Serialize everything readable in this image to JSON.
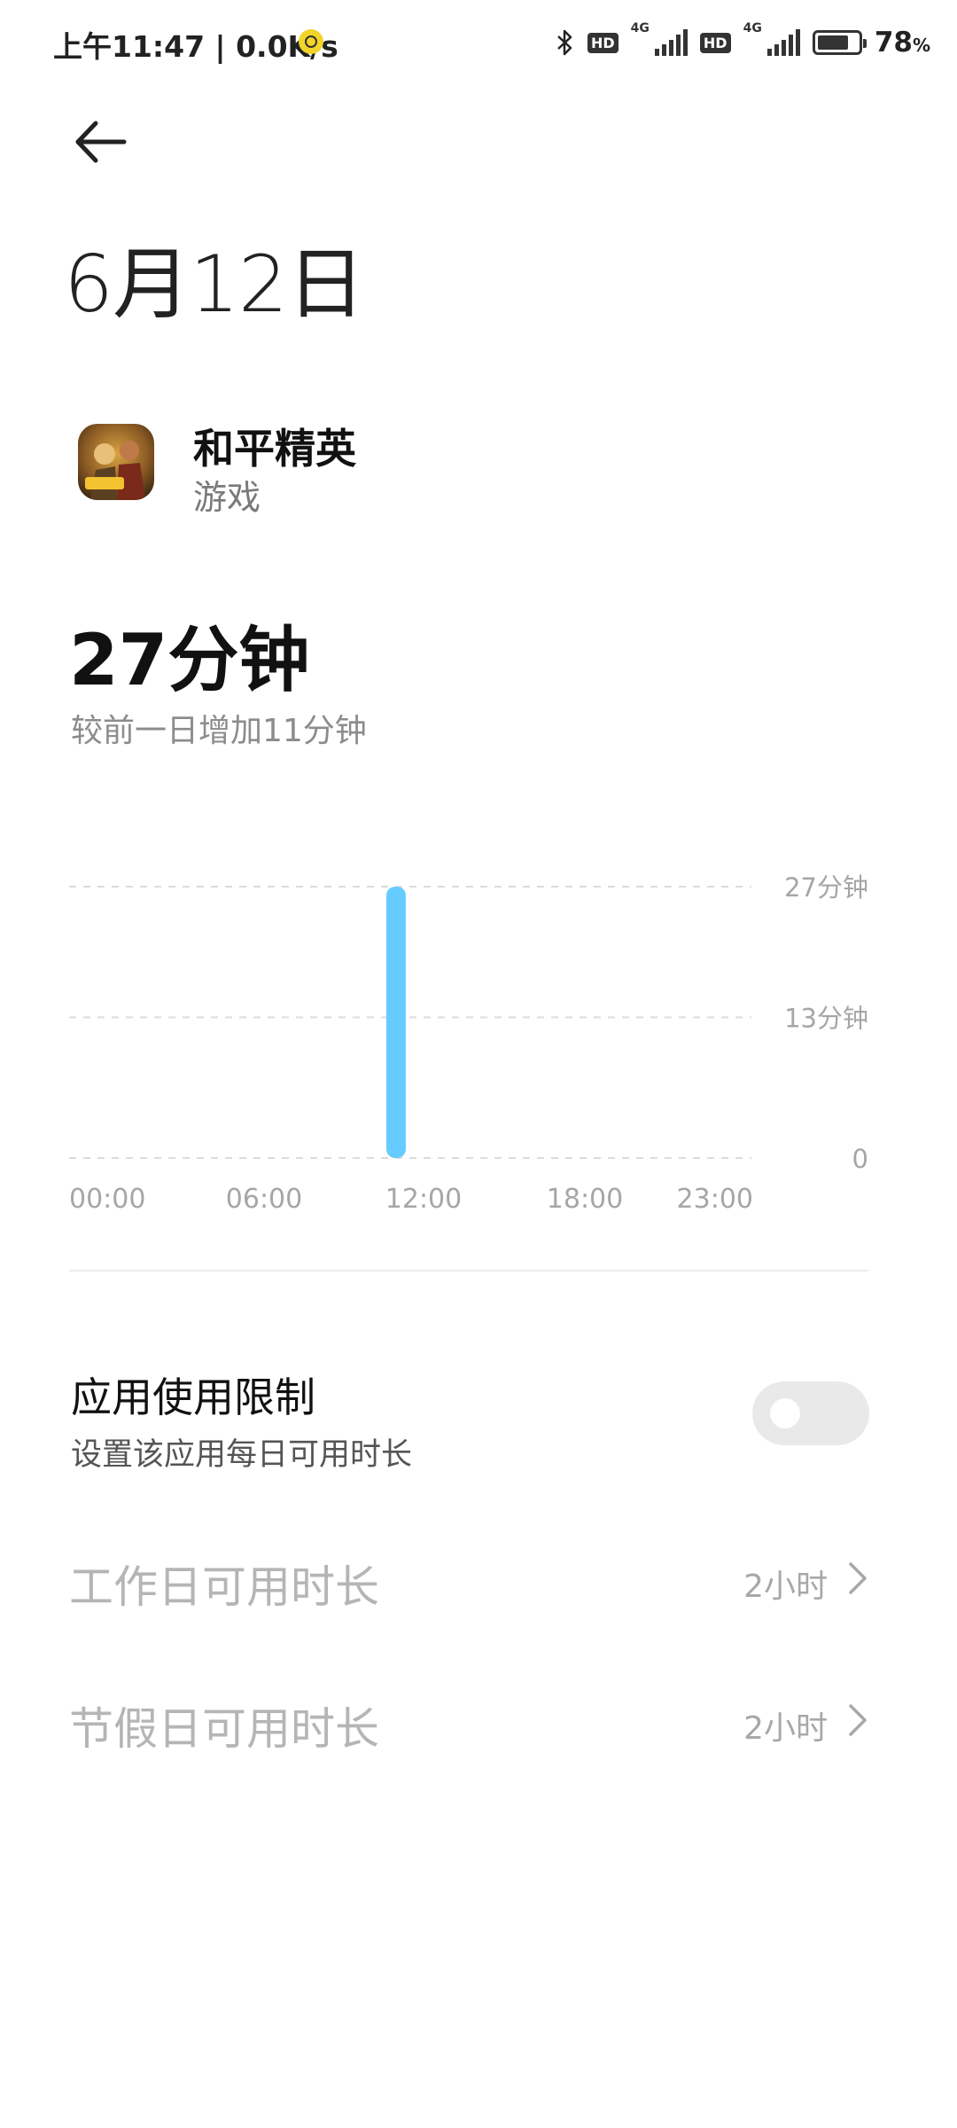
{
  "status_bar": {
    "time_and_speed": "上午11:47 | 0.0K/s",
    "network_type_1": "4G",
    "network_type_2": "4G",
    "hd_label_1": "HD",
    "hd_label_2": "HD",
    "battery_percent": 78,
    "battery_text": "78",
    "battery_unit": "%",
    "icons": [
      "notification-dot-icon",
      "bluetooth-icon",
      "hd-icon",
      "signal-icon",
      "hd-icon",
      "signal-icon",
      "battery-icon"
    ]
  },
  "header": {
    "back_icon": "arrow-left-icon",
    "title": "6月12日"
  },
  "app": {
    "name": "和平精英",
    "category": "游戏",
    "icon": "app-icon"
  },
  "usage": {
    "total": "27分钟",
    "comparison": "较前一日增加11分钟"
  },
  "chart_data": {
    "type": "bar",
    "x_tick_labels": [
      "00:00",
      "06:00",
      "12:00",
      "18:00",
      "23:00"
    ],
    "y_tick_labels": [
      "27分钟",
      "13分钟",
      "0"
    ],
    "ylim": [
      0,
      27
    ],
    "bars": [
      {
        "hour": 11,
        "value": 27
      }
    ],
    "bar_color": "#66ccff",
    "grid": true,
    "grid_style": "dashed"
  },
  "limit": {
    "title": "应用使用限制",
    "description": "设置该应用每日可用时长",
    "enabled": false
  },
  "rows": [
    {
      "label": "工作日可用时长",
      "value": "2小时",
      "icon": "chevron-right-icon"
    },
    {
      "label": "节假日可用时长",
      "value": "2小时",
      "icon": "chevron-right-icon"
    }
  ],
  "colors": {
    "accent": "#66ccff",
    "toggle_off": "#e9e9e9",
    "disabled_text": "#b5b5b5"
  }
}
